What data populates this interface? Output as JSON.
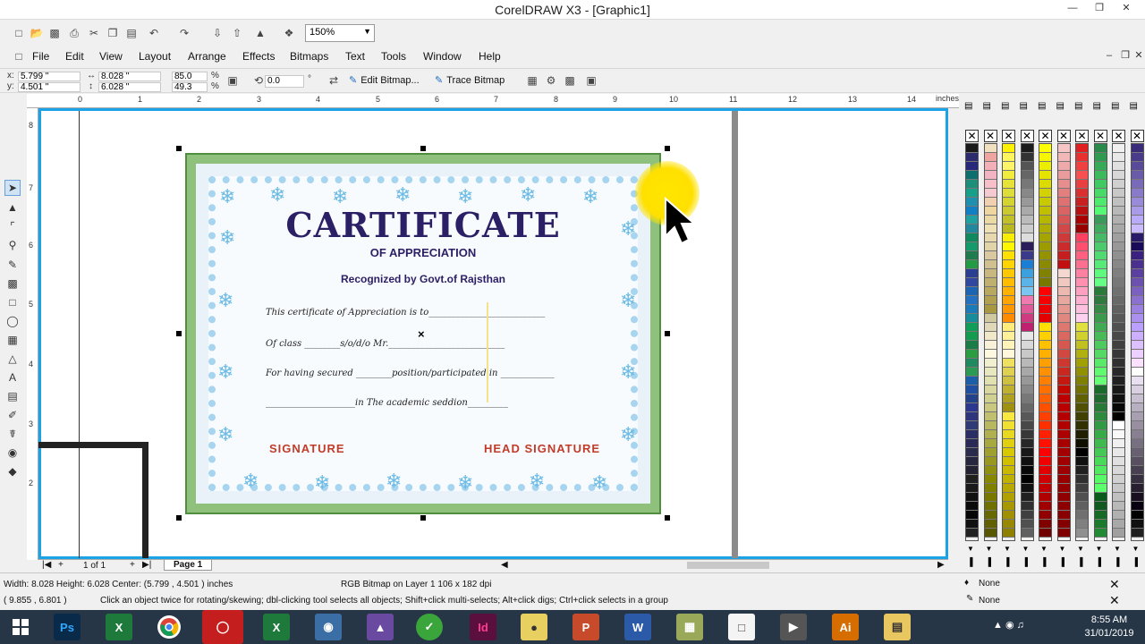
{
  "window": {
    "title": "CorelDRAW X3 - [Graphic1]"
  },
  "toolbar": {
    "zoom_value": "150%"
  },
  "menu": [
    "File",
    "Edit",
    "View",
    "Layout",
    "Arrange",
    "Effects",
    "Bitmaps",
    "Text",
    "Tools",
    "Window",
    "Help"
  ],
  "properties": {
    "x": "5.799 \"",
    "y": "4.501 \"",
    "width": "8.028 \"",
    "height": "6.028 \"",
    "scale_x": "85.0",
    "scale_y": "49.3",
    "percent": "%",
    "rotation": "0.0",
    "degree": "°",
    "edit_bitmap": "Edit Bitmap...",
    "trace_bitmap": "Trace Bitmap"
  },
  "ruler": {
    "unit": "inches",
    "h_ticks": [
      "0",
      "1",
      "2",
      "3",
      "4",
      "5",
      "6",
      "7",
      "8",
      "9",
      "10",
      "11",
      "12",
      "13",
      "14"
    ],
    "v_ticks": [
      "8",
      "7",
      "6",
      "5",
      "4",
      "3",
      "2"
    ]
  },
  "certificate": {
    "title": "CARTIFICATE",
    "subtitle": "OF APPRECIATION",
    "recognized": "Recognized by Govt.of Rajsthan",
    "line1": "This certificate of Appreciation is to__________________________",
    "line2": "Of class ________s/o/d/o Mr.__________________________",
    "line3": "For having secured ________position/participated in ____________",
    "line4": "____________________in The academic seddion_________",
    "signature": "SIGNATURE",
    "head_signature": "HEAD SIGNATURE"
  },
  "page_nav": {
    "page_count": "1 of 1",
    "page_tab": "Page 1"
  },
  "status": {
    "dimensions": "Width: 8.028  Height: 6.028  Center: (5.799 , 4.501 )  inches",
    "object_info": "RGB Bitmap on Layer 1 106 x 182 dpi",
    "cursor_pos": "( 9.855 , 6.801 )",
    "hint": "Click an object twice for rotating/skewing; dbl-clicking tool selects all objects; Shift+click multi-selects; Alt+click digs; Ctrl+click selects in a group",
    "fill": "None",
    "outline": "None"
  },
  "taskbar": {
    "time": "8:55 AM",
    "date": "31/01/2019",
    "apps": [
      "Ps",
      "X",
      "Id",
      "P",
      "W",
      "Ai"
    ]
  },
  "palette_colors": [
    [
      "#1a1a1a",
      "#2b2b6e",
      "#28287a",
      "#0e6f6f",
      "#1c8f7a",
      "#16a08a",
      "#1f8fb0",
      "#117fc4",
      "#20a0a0",
      "#21889d",
      "#0f8a5e",
      "#149a6b",
      "#1e7c4f",
      "#239b45",
      "#2a3f91",
      "#3048a0",
      "#1d64b3",
      "#2471c2",
      "#1a7bb8",
      "#178d9c",
      "#0f9d58",
      "#139b50",
      "#1a7d45",
      "#2b9d41",
      "#1f8a5f",
      "#2a9a55",
      "#1a5fa8",
      "#204ea0",
      "#22428a",
      "#2c3790",
      "#2e357c",
      "#303a76",
      "#2b2d65",
      "#2a2a58",
      "#2b2b4e",
      "#262640",
      "#222232",
      "#202020",
      "#1a1a1a",
      "#111111",
      "#0a0a0a",
      "#050505",
      "#111111",
      "#222222",
      "#333333",
      "#444444"
    ],
    [
      "#f1e0c0",
      "#f0a6a0",
      "#f3b0b8",
      "#f2b3c2",
      "#f7c0c8",
      "#f4c9d0",
      "#f0d0b0",
      "#efd5a0",
      "#ebd9a5",
      "#f0e0b5",
      "#e8d8b0",
      "#e0d4a8",
      "#d9c8a0",
      "#d0c090",
      "#c8b880",
      "#c0b070",
      "#b8a860",
      "#b0a050",
      "#a89840",
      "#d0c8a0",
      "#e0d8b8",
      "#f0e8c8",
      "#f8f0d8",
      "#fff8e0",
      "#f0f0d0",
      "#e8e8c0",
      "#e0e0b0",
      "#d8d8a0",
      "#d0d090",
      "#c8c880",
      "#c0c070",
      "#b8b860",
      "#b0b050",
      "#a8a840",
      "#a0a030",
      "#989820",
      "#909010",
      "#888800",
      "#808000",
      "#787800",
      "#707000",
      "#686800",
      "#606000",
      "#585800",
      "#505000",
      "#484800"
    ],
    [
      "#fff200",
      "#fff65f",
      "#fff36a",
      "#f2ed3c",
      "#e6e23a",
      "#dede3a",
      "#d4d430",
      "#caca30",
      "#c0c028",
      "#b8b820",
      "#f8ef00",
      "#fff700",
      "#ffe000",
      "#ffd400",
      "#ffc800",
      "#ffbc00",
      "#ffb000",
      "#ffa400",
      "#ff9800",
      "#ff8c00",
      "#ffec7a",
      "#fff09a",
      "#fff4ba",
      "#fff8da",
      "#f0e060",
      "#e0d050",
      "#d0c040",
      "#c0b030",
      "#b0a020",
      "#a09010",
      "#f8e840",
      "#f0e030",
      "#e8d820",
      "#e0d010",
      "#d8c800",
      "#d0c000",
      "#c8b800",
      "#c0b000",
      "#b8a800",
      "#b0a000",
      "#a89800",
      "#a09000",
      "#988800",
      "#908000",
      "#887800",
      "#807000"
    ],
    [
      "#1c1c1c",
      "#333333",
      "#555555",
      "#666666",
      "#777777",
      "#888888",
      "#999999",
      "#aaaaaa",
      "#bbbbbb",
      "#cccccc",
      "#dddddd",
      "#2b1c5c",
      "#3a3a8a",
      "#1a7fd4",
      "#3aa0e0",
      "#5ab4ea",
      "#7ac6f0",
      "#f07ab0",
      "#e05a9a",
      "#d03a80",
      "#c02070",
      "#e8e8e8",
      "#d8d8d8",
      "#c8c8c8",
      "#b8b8b8",
      "#a8a8a8",
      "#989898",
      "#888888",
      "#787878",
      "#686868",
      "#585858",
      "#484848",
      "#383838",
      "#282828",
      "#181818",
      "#101010",
      "#080808",
      "#000000",
      "#101010",
      "#202020",
      "#303030",
      "#404040",
      "#505050",
      "#606060",
      "#707070",
      "#808080"
    ],
    [
      "#ffff00",
      "#f6f600",
      "#eded00",
      "#e4e400",
      "#dbdb00",
      "#d2d200",
      "#c9c900",
      "#c0c000",
      "#b7b700",
      "#aeae00",
      "#a5a500",
      "#9c9c00",
      "#939300",
      "#8a8a00",
      "#818100",
      "#787800",
      "#ff0000",
      "#f60000",
      "#ed0000",
      "#e40000",
      "#ffe000",
      "#ffd000",
      "#ffc000",
      "#ffb000",
      "#ffa000",
      "#ff9000",
      "#ff8000",
      "#ff7000",
      "#ff6000",
      "#ff5000",
      "#ff4000",
      "#ff3000",
      "#ff2000",
      "#ff1000",
      "#ff0000",
      "#f00000",
      "#e00000",
      "#d00000",
      "#c00000",
      "#b00000",
      "#a00000",
      "#900000",
      "#800000",
      "#700000",
      "#600000",
      "#500000"
    ],
    [
      "#f6c6c6",
      "#f2b8b8",
      "#eeaaaa",
      "#ea9c9c",
      "#e68e8e",
      "#e28080",
      "#de7272",
      "#da6464",
      "#d65656",
      "#d24848",
      "#ce3a3a",
      "#ca2c2c",
      "#c61e1e",
      "#c21010",
      "#f4d8d0",
      "#f0c8c0",
      "#ecb8b0",
      "#e8a8a0",
      "#e49890",
      "#e08880",
      "#dc7870",
      "#d86860",
      "#d45850",
      "#d04840",
      "#cc3830",
      "#c82820",
      "#c41810",
      "#c00800",
      "#bc0000",
      "#b80000",
      "#b40000",
      "#b00000",
      "#ac0000",
      "#a80000",
      "#a40000",
      "#a00000",
      "#9c0000",
      "#980000",
      "#940000",
      "#900000",
      "#8c0000",
      "#880000",
      "#840000",
      "#800000",
      "#7c0000",
      "#780000"
    ],
    [
      "#e02020",
      "#e83030",
      "#f04040",
      "#f85050",
      "#e84040",
      "#d83030",
      "#c82020",
      "#b81010",
      "#a80000",
      "#980000",
      "#ff4060",
      "#ff5070",
      "#ff6080",
      "#ff7090",
      "#ff80a0",
      "#ff90b0",
      "#ffa0c0",
      "#ffb0d0",
      "#ffc0e0",
      "#ffd0f0",
      "#e0e040",
      "#d0d030",
      "#c0c020",
      "#b0b010",
      "#a0a000",
      "#909000",
      "#808000",
      "#707000",
      "#606000",
      "#505000",
      "#404000",
      "#303000",
      "#202000",
      "#101000",
      "#000000",
      "#101010",
      "#202020",
      "#303030",
      "#404040",
      "#505050",
      "#606060",
      "#707070",
      "#808080",
      "#909090",
      "#a0a0a0",
      "#b0b0b0"
    ],
    [
      "#2a8a4a",
      "#309a50",
      "#36aa56",
      "#3cba5c",
      "#42ca62",
      "#48da68",
      "#4eea6e",
      "#54fa74",
      "#3a9a5a",
      "#40aa60",
      "#46ba66",
      "#4cca6c",
      "#52da72",
      "#58ea78",
      "#5efa7e",
      "#64ff84",
      "#2a7a3a",
      "#307a40",
      "#368a46",
      "#3c9a4c",
      "#42aa52",
      "#48ba58",
      "#4eca5e",
      "#54da64",
      "#5aea6a",
      "#60fa70",
      "#66ff76",
      "#1a6a2a",
      "#206a30",
      "#267a36",
      "#2c8a3c",
      "#329a42",
      "#38aa48",
      "#3eba4e",
      "#44ca54",
      "#4ada5a",
      "#50ea60",
      "#56fa66",
      "#5cff6c",
      "#0a5a1a",
      "#105a20",
      "#166a26",
      "#1c7a2c",
      "#228a32",
      "#289a38",
      "#2eaa3e"
    ],
    [
      "#f0f0f0",
      "#e8e8e8",
      "#e0e0e0",
      "#d8d8d8",
      "#d0d0d0",
      "#c8c8c8",
      "#c0c0c0",
      "#b8b8b8",
      "#b0b0b0",
      "#a8a8a8",
      "#a0a0a0",
      "#989898",
      "#909090",
      "#888888",
      "#808080",
      "#787878",
      "#707070",
      "#686868",
      "#606060",
      "#585858",
      "#505050",
      "#484848",
      "#404040",
      "#383838",
      "#303030",
      "#282828",
      "#202020",
      "#181818",
      "#101010",
      "#080808",
      "#000000",
      "#ffffff",
      "#f8f8f8",
      "#f0f0f0",
      "#e8e8e8",
      "#e0e0e0",
      "#d8d8d8",
      "#d0d0d0",
      "#c8c8c8",
      "#c0c0c0",
      "#b8b8b8",
      "#b0b0b0",
      "#a8a8a8",
      "#a0a0a0",
      "#989898",
      "#909090"
    ],
    [
      "#3a2a7a",
      "#4a3a8a",
      "#5a4a9a",
      "#6a5aaa",
      "#7a6aba",
      "#8a7aca",
      "#9a8ada",
      "#aa9aea",
      "#baaafa",
      "#cabaff",
      "#2a1a6a",
      "#1a0a5a",
      "#3c2080",
      "#4c3090",
      "#5c40a0",
      "#6c50b0",
      "#7c60c0",
      "#8c70d0",
      "#9c80e0",
      "#ac90f0",
      "#bca0ff",
      "#ccb0ff",
      "#dcc0ff",
      "#ecd0ff",
      "#fce0ff",
      "#ffffff",
      "#e8e0f0",
      "#d8d0e0",
      "#c8c0d0",
      "#b8b0c0",
      "#a8a0b0",
      "#9890a0",
      "#888090",
      "#787080",
      "#686070",
      "#585060",
      "#484050",
      "#383040",
      "#282030",
      "#181020",
      "#080010",
      "#000000",
      "#101010",
      "#202020",
      "#303030",
      "#404040"
    ]
  ]
}
